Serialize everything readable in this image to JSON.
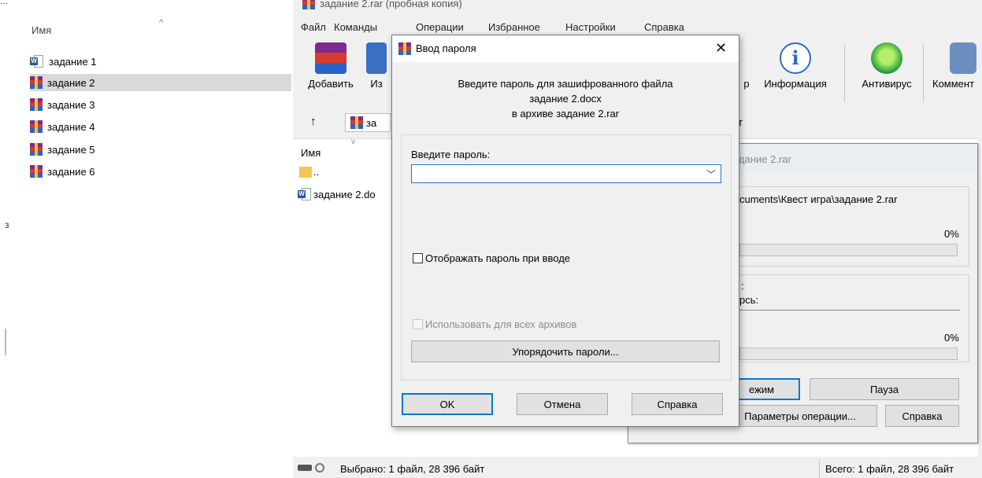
{
  "explorer": {
    "column_header": "Имя",
    "breadcrumb_fragment": "...",
    "side_mark": "з",
    "items": [
      {
        "label": "задание 1",
        "icon": "word-doc-icon",
        "selected": false
      },
      {
        "label": "задание 2",
        "icon": "rar-archive-icon",
        "selected": true
      },
      {
        "label": "задание 3",
        "icon": "rar-archive-icon",
        "selected": false
      },
      {
        "label": "задание 4",
        "icon": "rar-archive-icon",
        "selected": false
      },
      {
        "label": "задание 5",
        "icon": "rar-archive-icon",
        "selected": false
      },
      {
        "label": "задание 6",
        "icon": "rar-archive-icon",
        "selected": false
      }
    ]
  },
  "winrar": {
    "title": "задание 2.rar (пробная копия)",
    "menu": [
      "Файл",
      "Команды",
      "Операции",
      "Избранное",
      "Настройки",
      "Справка"
    ],
    "toolbar": {
      "add": "Добавить",
      "extract_partial": "Из",
      "view_partial": "р",
      "info": "Информация",
      "antivirus": "Антивирус",
      "comment_partial": "Коммент"
    },
    "address": {
      "archive_partial": "за",
      "tail_partial": "т"
    },
    "filelist": {
      "column_name": "Имя",
      "rows": [
        {
          "name": "..",
          "icon": "folder-icon"
        },
        {
          "name": "задание 2.do",
          "icon": "word-doc-icon"
        }
      ]
    },
    "status": {
      "left": "Выбрано: 1 файл, 28 396 байт",
      "right": "Всего: 1 файл, 28 396 байт"
    }
  },
  "progress": {
    "title_partial": "дание 2.rar",
    "path_partial": "cuments\\Квест игра\\задание 2.rar",
    "percent1": "0%",
    "label_a": ":",
    "label_b": "рсь:",
    "percent2": "0%",
    "buttons": {
      "mode_partial": "ежим",
      "pause": "Пауза",
      "params": "Параметры операции...",
      "help": "Справка"
    }
  },
  "dialog": {
    "title": "Ввод пароля",
    "info_line1": "Введите пароль для зашифрованного файла",
    "info_line2": "задание 2.docx",
    "info_line3": "в архиве задание 2.rar",
    "password_label": "Введите пароль:",
    "password_value": "",
    "show_password_label": "Отображать пароль при вводе",
    "use_for_all_label": "Использовать для всех архивов",
    "organize_button": "Упорядочить пароли...",
    "ok": "OK",
    "cancel": "Отмена",
    "help": "Справка"
  },
  "colors": {
    "accent": "#0078d7",
    "selection": "#d9d9d9",
    "window_bg": "#f0f0f0"
  }
}
